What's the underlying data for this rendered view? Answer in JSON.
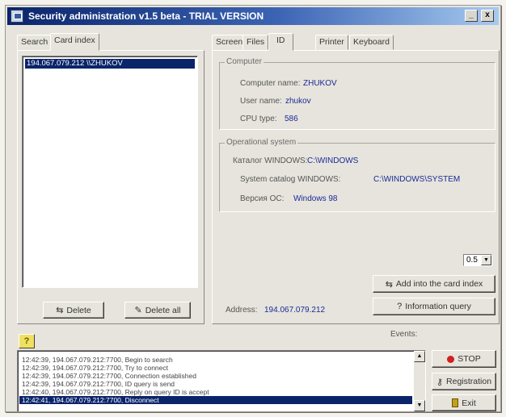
{
  "window": {
    "title": "Security administration v1.5 beta - TRIAL VERSION",
    "controls": {
      "minimize": "_",
      "maximize": "□",
      "close": "x"
    }
  },
  "left_tabs": [
    "Search",
    "Card index"
  ],
  "card_list": {
    "selected_item": "194.067.079.212 \\\\ZHUKOV"
  },
  "left_buttons": {
    "delete": "Delete",
    "delete_all": "Delete all"
  },
  "right_tabs": [
    "Screen",
    "Files",
    "ID",
    "Printer",
    "Keyboard"
  ],
  "computer": {
    "group_label": "Computer",
    "name_label": "Computer name:",
    "name_value": "ZHUKOV",
    "user_label": "User name:",
    "user_value": "zhukov",
    "cpu_label": "CPU type:",
    "cpu_value": "586"
  },
  "os": {
    "group_label": "Operational system",
    "catalog_label": "Каталог WINDOWS:",
    "catalog_value": "C:\\WINDOWS",
    "system_label": "System catalog WINDOWS:",
    "system_value": "C:\\WINDOWS\\SYSTEM",
    "version_label": "Версия ОС:",
    "version_value": "Windows 98"
  },
  "timeout_select": {
    "value": "0.5"
  },
  "actions": {
    "add_card": "Add into the card index",
    "info_query": "Information query"
  },
  "address": {
    "label": "Address:",
    "value": "194.067.079.212"
  },
  "events": {
    "label": "Events:",
    "lines": [
      "12:42:39, 194.067.079.212:7700, Begin to search",
      "12:42:39, 194.067.079.212:7700, Try to connect",
      "12:42:39, 194.067.079.212:7700, Connection established",
      "12:42:39, 194.067.079.212:7700, ID query is send",
      "12:42:40, 194.067.079.212:7700, Reply on query ID is accept",
      "12:42:41, 194.067.079.212:7700, Disconnect"
    ]
  },
  "side_buttons": {
    "stop": "STOP",
    "registration": "Registration",
    "exit": "Exit"
  },
  "help_button": "?"
}
